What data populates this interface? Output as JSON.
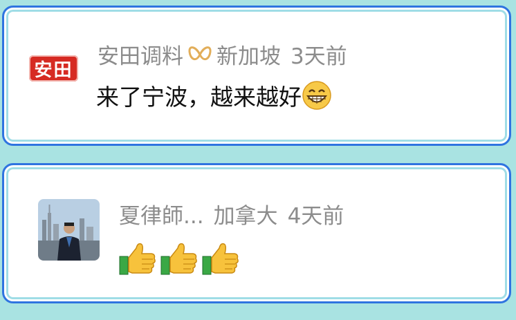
{
  "comments": [
    {
      "avatar_text": "安田",
      "name": "安田调料",
      "badge_icon": "vip-badge-icon",
      "location": "新加坡",
      "time": "3天前",
      "text": "来了宁波，越来越好",
      "emoji": "grinning-face-icon"
    },
    {
      "avatar_icon": "user-photo-avatar",
      "name": "夏律師...",
      "location": "加拿大",
      "time": "4天前",
      "emojis": [
        "thumbs-up-icon",
        "thumbs-up-icon",
        "thumbs-up-icon"
      ]
    }
  ],
  "colors": {
    "background": "#a9e3e2",
    "card_border": "#2f74e0",
    "meta_text": "#8c8c8c",
    "logo_red": "#d62a22"
  }
}
